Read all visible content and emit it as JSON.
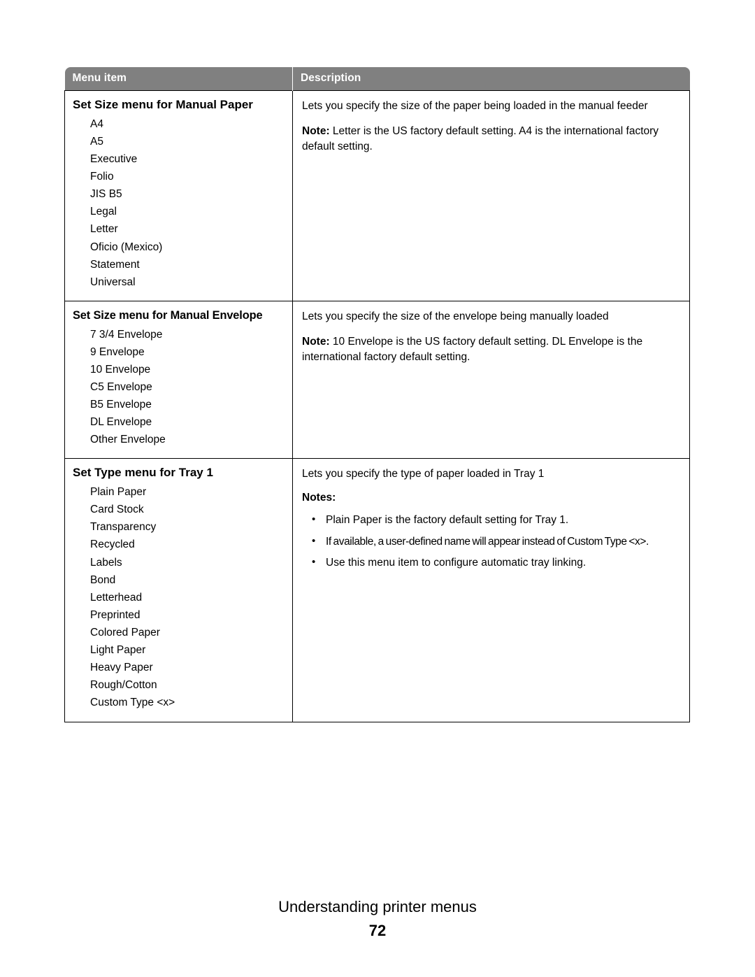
{
  "table": {
    "headers": {
      "menu_item": "Menu item",
      "description": "Description"
    },
    "header_bg": "#808080",
    "header_fg": "#ffffff",
    "rows": [
      {
        "title": "Set Size menu for Manual Paper",
        "options": [
          "A4",
          "A5",
          "Executive",
          "Folio",
          "JIS B5",
          "Legal",
          "Letter",
          "Oficio (Mexico)",
          "Statement",
          "Universal"
        ],
        "description": "Lets you specify the size of the paper being loaded in the manual feeder",
        "note_label": "Note:",
        "note_text": "Letter is the US factory default setting. A4 is the international factory default setting."
      },
      {
        "title": "Set Size menu for Manual Envelope",
        "options": [
          "7 3/4 Envelope",
          "9 Envelope",
          "10 Envelope",
          "C5 Envelope",
          "B5 Envelope",
          "DL Envelope",
          "Other Envelope"
        ],
        "description": "Lets you specify the size of the envelope being manually loaded",
        "note_label": "Note:",
        "note_text": "10 Envelope is the US factory default setting. DL Envelope is the international factory default setting."
      },
      {
        "title": "Set Type menu for Tray 1",
        "options": [
          "Plain Paper",
          "Card Stock",
          "Transparency",
          "Recycled",
          "Labels",
          "Bond",
          "Letterhead",
          "Preprinted",
          "Colored Paper",
          "Light Paper",
          "Heavy Paper",
          "Rough/Cotton",
          "Custom Type <x>"
        ],
        "description": "Lets you specify the type of paper loaded in Tray 1",
        "notes_label": "Notes:",
        "notes": [
          "Plain Paper is the factory default setting for Tray 1.",
          "If available, a user-defined name will appear instead of Custom Type <x>.",
          "Use this menu item to configure automatic tray linking."
        ]
      }
    ]
  },
  "footer": {
    "section_title": "Understanding printer menus",
    "page_number": "72"
  }
}
